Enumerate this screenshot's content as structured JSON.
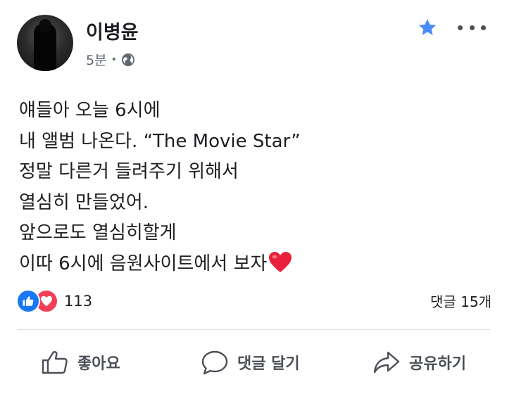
{
  "post": {
    "author": "이병윤",
    "time": "5분",
    "separator": "•",
    "privacy_icon": "globe-icon",
    "lines": [
      "얘들아 오늘 6시에",
      "내 앨범 나온다. “The Movie Star”",
      "정말 다른거 들려주기 위해서",
      "열심히 만들었어.",
      "앞으로도 열심히할게",
      "이따 6시에 음원사이트에서 보자"
    ],
    "trailing_emoji": "red-heart-icon"
  },
  "reactions": {
    "icons": [
      "like-icon",
      "love-icon"
    ],
    "count": "113"
  },
  "comments": {
    "count_label": "댓글 15개"
  },
  "actions": {
    "like_label": "좋아요",
    "comment_label": "댓글 달기",
    "share_label": "공유하기"
  },
  "colors": {
    "accent": "#4c8bf5",
    "like_blue": "#1877f2",
    "love_red": "#f33e58",
    "heart_red": "#e8203b",
    "text_dark": "#1c1e21",
    "text_muted": "#606770",
    "icon_gray": "#4b4f56"
  }
}
